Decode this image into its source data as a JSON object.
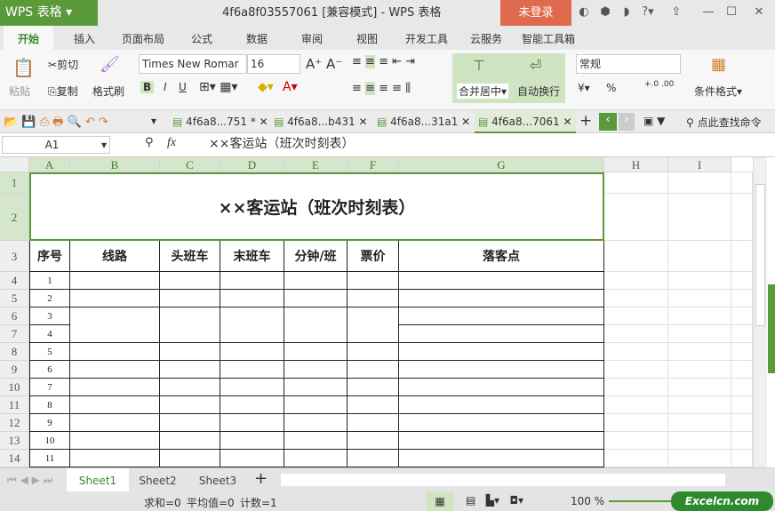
{
  "app": {
    "logo": "WPS 表格",
    "title": "4f6a8f03557061 [兼容模式] - WPS 表格",
    "login": "未登录"
  },
  "menu": [
    "开始",
    "插入",
    "页面布局",
    "公式",
    "数据",
    "审阅",
    "视图",
    "开发工具",
    "云服务",
    "智能工具箱"
  ],
  "ribbon": {
    "paste": "粘贴",
    "cut": "剪切",
    "copy": "复制",
    "format_painter": "格式刷",
    "font": "Times New Romar",
    "size": "16",
    "merge": "合并居中",
    "wrap": "自动换行",
    "number_format": "常规",
    "cond_format": "条件格式",
    "bold": "B",
    "italic": "I",
    "underline": "U",
    "percent": "%"
  },
  "doc_tabs": [
    "4f6a8...751 *",
    "4f6a8...b431",
    "4f6a8...31a1",
    "4f6a8...7061"
  ],
  "search_cmd": "点此查找命令",
  "formula": {
    "name_box": "A1",
    "fx": "fx",
    "content": "××客运站（班次时刻表）"
  },
  "columns": [
    "A",
    "B",
    "C",
    "D",
    "E",
    "F",
    "G",
    "H",
    "I"
  ],
  "rows": [
    "1",
    "2",
    "3",
    "4",
    "5",
    "6",
    "7",
    "8",
    "9",
    "10",
    "11",
    "12",
    "13",
    "14"
  ],
  "table": {
    "title": "××客运站（班次时刻表）",
    "headers": [
      "序号",
      "线路",
      "头班车",
      "末班车",
      "分钟/班",
      "票价",
      "落客点"
    ],
    "seq": [
      "1",
      "2",
      "3",
      "4",
      "5",
      "6",
      "7",
      "8",
      "9",
      "10",
      "11"
    ]
  },
  "sheets": [
    "Sheet1",
    "Sheet2",
    "Sheet3"
  ],
  "status": {
    "sum": "求和=0",
    "avg": "平均值=0",
    "count": "计数=1",
    "zoom": "100 %",
    "watermark": "Excelcn.com"
  }
}
